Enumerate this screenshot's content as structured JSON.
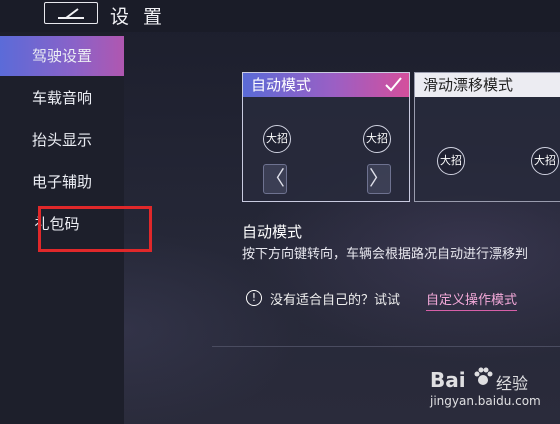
{
  "header": {
    "title": "设 置",
    "back_icon": "back-icon"
  },
  "sidebar": {
    "items": [
      {
        "label": "驾驶设置",
        "active": true
      },
      {
        "label": "车载音响",
        "active": false
      },
      {
        "label": "抬头显示",
        "active": false
      },
      {
        "label": "电子辅助",
        "active": false
      },
      {
        "label": "礼包码",
        "active": false
      }
    ]
  },
  "modes": {
    "cards": [
      {
        "label": "自动模式",
        "selected": true,
        "skill_left": "大招",
        "skill_right": "大招",
        "arrow_left": "〈",
        "arrow_right": "〉"
      },
      {
        "label": "滑动漂移模式",
        "selected": false,
        "skill_left": "大招",
        "skill_right": "大招"
      }
    ]
  },
  "detail": {
    "name": "自动模式",
    "description": "按下方向键转向，车辆会根据路况自动进行漂移判"
  },
  "tip": {
    "icon": "!",
    "text": "没有适合自己的？试试",
    "link": "自定义操作模式"
  },
  "watermark": {
    "brand": "Bai",
    "brand2": "经验",
    "url": "jingyan.baidu.com"
  },
  "colors": {
    "accent_start": "#5a6bd6",
    "accent_end": "#d44f9c",
    "highlight_box": "#e0282a",
    "link": "#f3a9d9"
  }
}
